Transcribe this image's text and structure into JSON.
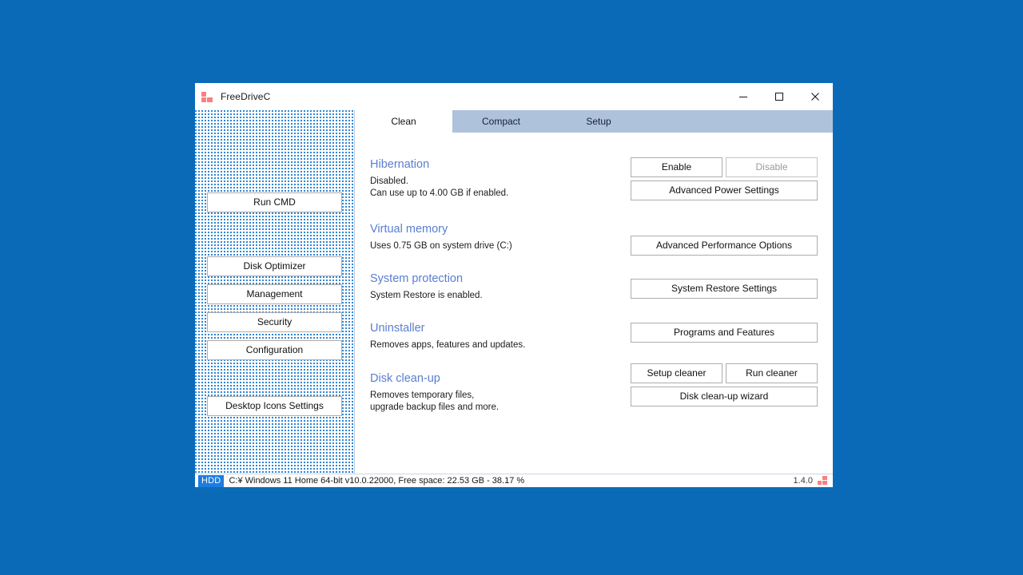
{
  "window": {
    "title": "FreeDriveC",
    "logo_icon": "app-squares-icon",
    "controls": {
      "minimize": "minimize-icon",
      "maximize": "maximize-icon",
      "close": "close-icon"
    }
  },
  "sidebar": {
    "buttons": [
      {
        "label": "Run CMD",
        "name": "run-cmd"
      },
      {
        "label": "Disk Optimizer",
        "name": "disk-optimizer"
      },
      {
        "label": "Management",
        "name": "management"
      },
      {
        "label": "Security",
        "name": "security"
      },
      {
        "label": "Configuration",
        "name": "configuration"
      },
      {
        "label": "Desktop Icons Settings",
        "name": "desktop-icons-settings"
      }
    ]
  },
  "tabs": [
    {
      "label": "Clean",
      "active": true
    },
    {
      "label": "Compact",
      "active": false
    },
    {
      "label": "Setup",
      "active": false
    }
  ],
  "sections": {
    "hibernation": {
      "title": "Hibernation",
      "desc": "Disabled.\nCan use up to 4.00 GB if enabled.",
      "buttons": {
        "enable": "Enable",
        "disable": "Disable",
        "advanced_power": "Advanced Power Settings"
      }
    },
    "virtual_memory": {
      "title": "Virtual memory",
      "desc": "Uses 0.75 GB on system drive (C:)",
      "buttons": {
        "advanced_performance": "Advanced Performance Options"
      }
    },
    "system_protection": {
      "title": "System protection",
      "desc": "System Restore is enabled.",
      "buttons": {
        "restore_settings": "System Restore Settings"
      }
    },
    "uninstaller": {
      "title": "Uninstaller",
      "desc": "Removes apps, features and updates.",
      "buttons": {
        "programs_features": "Programs and Features"
      }
    },
    "disk_cleanup": {
      "title": "Disk clean-up",
      "desc": "Removes temporary files,\nupgrade backup files and more.",
      "buttons": {
        "setup_cleaner": "Setup cleaner",
        "run_cleaner": "Run cleaner",
        "wizard": "Disk clean-up wizard"
      }
    }
  },
  "status_bar": {
    "badge": "HDD",
    "text": "C:¥ Windows 11 Home 64-bit v10.0.22000, Free space: 22.53 GB - 38.17 %",
    "version": "1.4.0",
    "logo_icon": "app-squares-icon"
  },
  "colors": {
    "desktop": "#0a6ab8",
    "accent_heading": "#5a7ed0",
    "tab_inactive": "#aec3db",
    "badge": "#1d7ce0",
    "logo": "#f98080",
    "window_border": "#0b6cb8"
  }
}
